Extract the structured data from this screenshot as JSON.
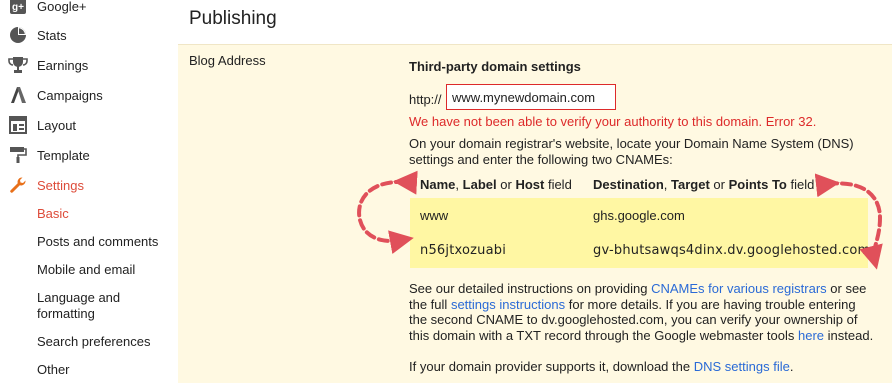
{
  "sidebar": {
    "items": [
      {
        "label": "Google+",
        "icon": "google-plus-icon"
      },
      {
        "label": "Stats",
        "icon": "pie-chart-icon"
      },
      {
        "label": "Earnings",
        "icon": "trophy-icon"
      },
      {
        "label": "Campaigns",
        "icon": "adwords-icon"
      },
      {
        "label": "Layout",
        "icon": "layout-icon"
      },
      {
        "label": "Template",
        "icon": "paint-roller-icon"
      },
      {
        "label": "Settings",
        "icon": "wrench-icon"
      }
    ],
    "subitems": [
      "Basic",
      "Posts and comments",
      "Mobile and email",
      "Language and formatting",
      "Search preferences",
      "Other"
    ],
    "active_color": "#dd4b39"
  },
  "page": {
    "title": "Publishing",
    "row_label": "Blog Address",
    "section_heading": "Third-party domain settings",
    "http_prefix": "http://",
    "domain_value": "www.mynewdomain.com",
    "error": "We have not been able to verify your authority to this domain. Error 32.",
    "intro": "On your domain registrar's website, locate your Domain Name System (DNS) settings and enter the following two CNAMEs:",
    "col1": {
      "name": "Name",
      "label": "Label",
      "or": "or",
      "host": "Host",
      "field": "field"
    },
    "col2": {
      "dest": "Destination",
      "target": "Target",
      "or": "or",
      "points": "Points To",
      "field": "field"
    },
    "records": [
      {
        "name": "www",
        "destination": "ghs.google.com"
      },
      {
        "name": "n56jtxozuabi",
        "destination": "gv-bhutsawqs4dinx.dv.googlehosted.com"
      }
    ],
    "details": {
      "p1": "See our detailed instructions on providing",
      "link1": "CNAMEs for various registrars",
      "p2": "or see the full",
      "link2": "settings instructions",
      "p3": "for more details. If you are having trouble entering the second CNAME to dv.googlehosted.com, you can verify your ownership of this domain with a TXT record through the Google webmaster tools",
      "link3": "here",
      "p4": "instead."
    },
    "footer": {
      "p1": "If your domain provider supports it, download the",
      "link": "DNS settings file",
      "p2": "."
    },
    "colors": {
      "panel": "#fff9e2",
      "records": "#fff7a3",
      "error": "#dd2a2a",
      "link": "#2a6ad6",
      "arrow": "#e0505a"
    }
  }
}
